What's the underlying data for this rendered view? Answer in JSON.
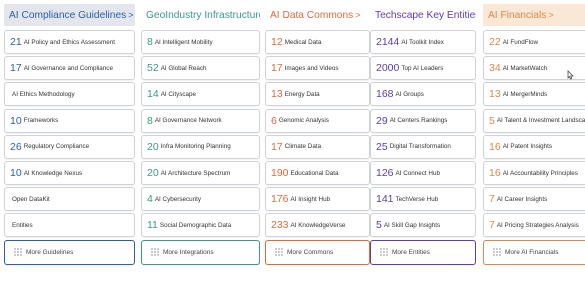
{
  "columns": [
    {
      "title": "AI Compliance Guidelines",
      "chevron": ">",
      "color": "#2b5fa8",
      "head_bg": "#e3e7ed",
      "more_label": "More Guidelines",
      "items": [
        {
          "number": "21",
          "label": "AI Policy and Ethics Assessment"
        },
        {
          "number": "17",
          "label": "AI Governance and Compliance"
        },
        {
          "number": "",
          "label": "AI Ethics Methodology"
        },
        {
          "number": "10",
          "label": "Frameworks"
        },
        {
          "number": "26",
          "label": "Regulatory Compliance"
        },
        {
          "number": "10",
          "label": "AI Knowledge Nexus"
        },
        {
          "number": "",
          "label": "Open DataKit"
        },
        {
          "number": "",
          "label": "Entities"
        }
      ]
    },
    {
      "title": "GeoIndustry Infrastructure",
      "chevron": ">",
      "color": "#3a9a86",
      "head_bg": "#ffffff",
      "more_label": "More Integrations",
      "items": [
        {
          "number": "8",
          "label": "AI Intelligent Mobility"
        },
        {
          "number": "52",
          "label": "AI Global Reach"
        },
        {
          "number": "14",
          "label": "AI Cityscape"
        },
        {
          "number": "8",
          "label": "AI Governance Network"
        },
        {
          "number": "20",
          "label": "Infra Monitoring Planning"
        },
        {
          "number": "20",
          "label": "AI Architecture Spectrum"
        },
        {
          "number": "4",
          "label": "AI Cybersecurity"
        },
        {
          "number": "11",
          "label": "Social Demographic Data"
        }
      ]
    },
    {
      "title": "AI Data Commons",
      "chevron": ">",
      "color": "#e06a3b",
      "head_bg": "#ffffff",
      "more_label": "More Commons",
      "items": [
        {
          "number": "12",
          "label": "Medical Data"
        },
        {
          "number": "17",
          "label": "Images and Videos"
        },
        {
          "number": "13",
          "label": "Energy Data"
        },
        {
          "number": "6",
          "label": "Genomic Analysis"
        },
        {
          "number": "17",
          "label": "Climate Data"
        },
        {
          "number": "190",
          "label": "Educational Data"
        },
        {
          "number": "176",
          "label": "AI Insight Hub"
        },
        {
          "number": "233",
          "label": "AI KnowledgeVerse"
        }
      ]
    },
    {
      "title": "Techscape Key Entities",
      "chevron": ">",
      "color": "#5b3fa6",
      "head_bg": "#ffffff",
      "more_label": "More Entities",
      "items": [
        {
          "number": "2144",
          "label": "AI Toolkit Index"
        },
        {
          "number": "2000",
          "label": "Top AI Leaders"
        },
        {
          "number": "168",
          "label": "AI Groups"
        },
        {
          "number": "29",
          "label": "AI Centers Rankings"
        },
        {
          "number": "25",
          "label": "Digital Transformation"
        },
        {
          "number": "126",
          "label": "AI Connect Hub"
        },
        {
          "number": "141",
          "label": "TechVerse Hub"
        },
        {
          "number": "5",
          "label": "AI Skill Gap Insights"
        }
      ]
    },
    {
      "title": "AI Financials",
      "chevron": ">",
      "color": "#d9894a",
      "head_bg": "#fbe7d6",
      "more_label": "More AI Financials",
      "items": [
        {
          "number": "22",
          "label": "AI FundFlow"
        },
        {
          "number": "34",
          "label": "AI MarketWatch"
        },
        {
          "number": "13",
          "label": "AI MergerMinds"
        },
        {
          "number": "5",
          "label": "AI Talent & Investment Landscape"
        },
        {
          "number": "16",
          "label": "AI Patent Insights"
        },
        {
          "number": "16",
          "label": "AI Accountability Principles"
        },
        {
          "number": "7",
          "label": "AI Career Insights"
        },
        {
          "number": "7",
          "label": "AI Pricing Strategies Analysis"
        }
      ]
    }
  ]
}
